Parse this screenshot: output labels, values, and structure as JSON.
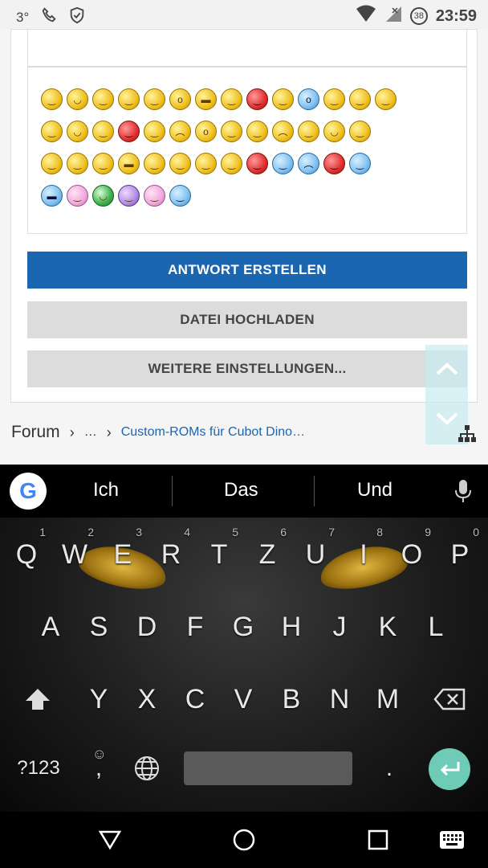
{
  "status_bar": {
    "temperature": "3°",
    "battery_level": "38",
    "time": "23:59",
    "icons": [
      "phone-wifi-icon",
      "shield-icon",
      "wifi-icon",
      "signal-icon"
    ]
  },
  "composer": {
    "smiley_rows": [
      [
        "angry",
        "grin",
        "neutral",
        "blush",
        "confused",
        "huh",
        "cool",
        "roll",
        "mad",
        "sick",
        "shock",
        "pout",
        "wink",
        "innocent"
      ],
      [
        "smile",
        "bigsmile",
        "rolleyes",
        "love",
        "annoyed",
        "sad",
        "surprised",
        "tongue",
        "dizzy",
        "worried",
        "mustache",
        "happy",
        "smirk"
      ],
      [
        "sneeze",
        "thumb-left",
        "thumbs-up",
        "shades",
        "lick",
        "whistle",
        "eyes",
        "blank",
        "inlove",
        "cold",
        "frown",
        "angry-red",
        "question"
      ],
      [
        "cool-blue",
        "drool",
        "teeth",
        "purple",
        "pink",
        "blue-smile"
      ]
    ],
    "buttons": {
      "reply": "ANTWORT ERSTELLEN",
      "upload": "DATEI HOCHLADEN",
      "more_settings": "WEITERE EINSTELLUNGEN..."
    }
  },
  "breadcrumb": {
    "home": "Forum",
    "ellipsis": "…",
    "current": "Custom-ROMs für Cubot Dino…"
  },
  "keyboard": {
    "suggestions": [
      "Ich",
      "Das",
      "Und"
    ],
    "row1": [
      {
        "k": "Q",
        "h": "1"
      },
      {
        "k": "W",
        "h": "2"
      },
      {
        "k": "E",
        "h": "3"
      },
      {
        "k": "R",
        "h": "4"
      },
      {
        "k": "T",
        "h": "5"
      },
      {
        "k": "Z",
        "h": "6"
      },
      {
        "k": "U",
        "h": "7"
      },
      {
        "k": "I",
        "h": "8"
      },
      {
        "k": "O",
        "h": "9"
      },
      {
        "k": "P",
        "h": "0"
      }
    ],
    "row2": [
      "A",
      "S",
      "D",
      "F",
      "G",
      "H",
      "J",
      "K",
      "L"
    ],
    "row3": [
      "Y",
      "X",
      "C",
      "V",
      "B",
      "N",
      "M"
    ],
    "symbols_key": "?123",
    "comma": ",",
    "period": "."
  }
}
